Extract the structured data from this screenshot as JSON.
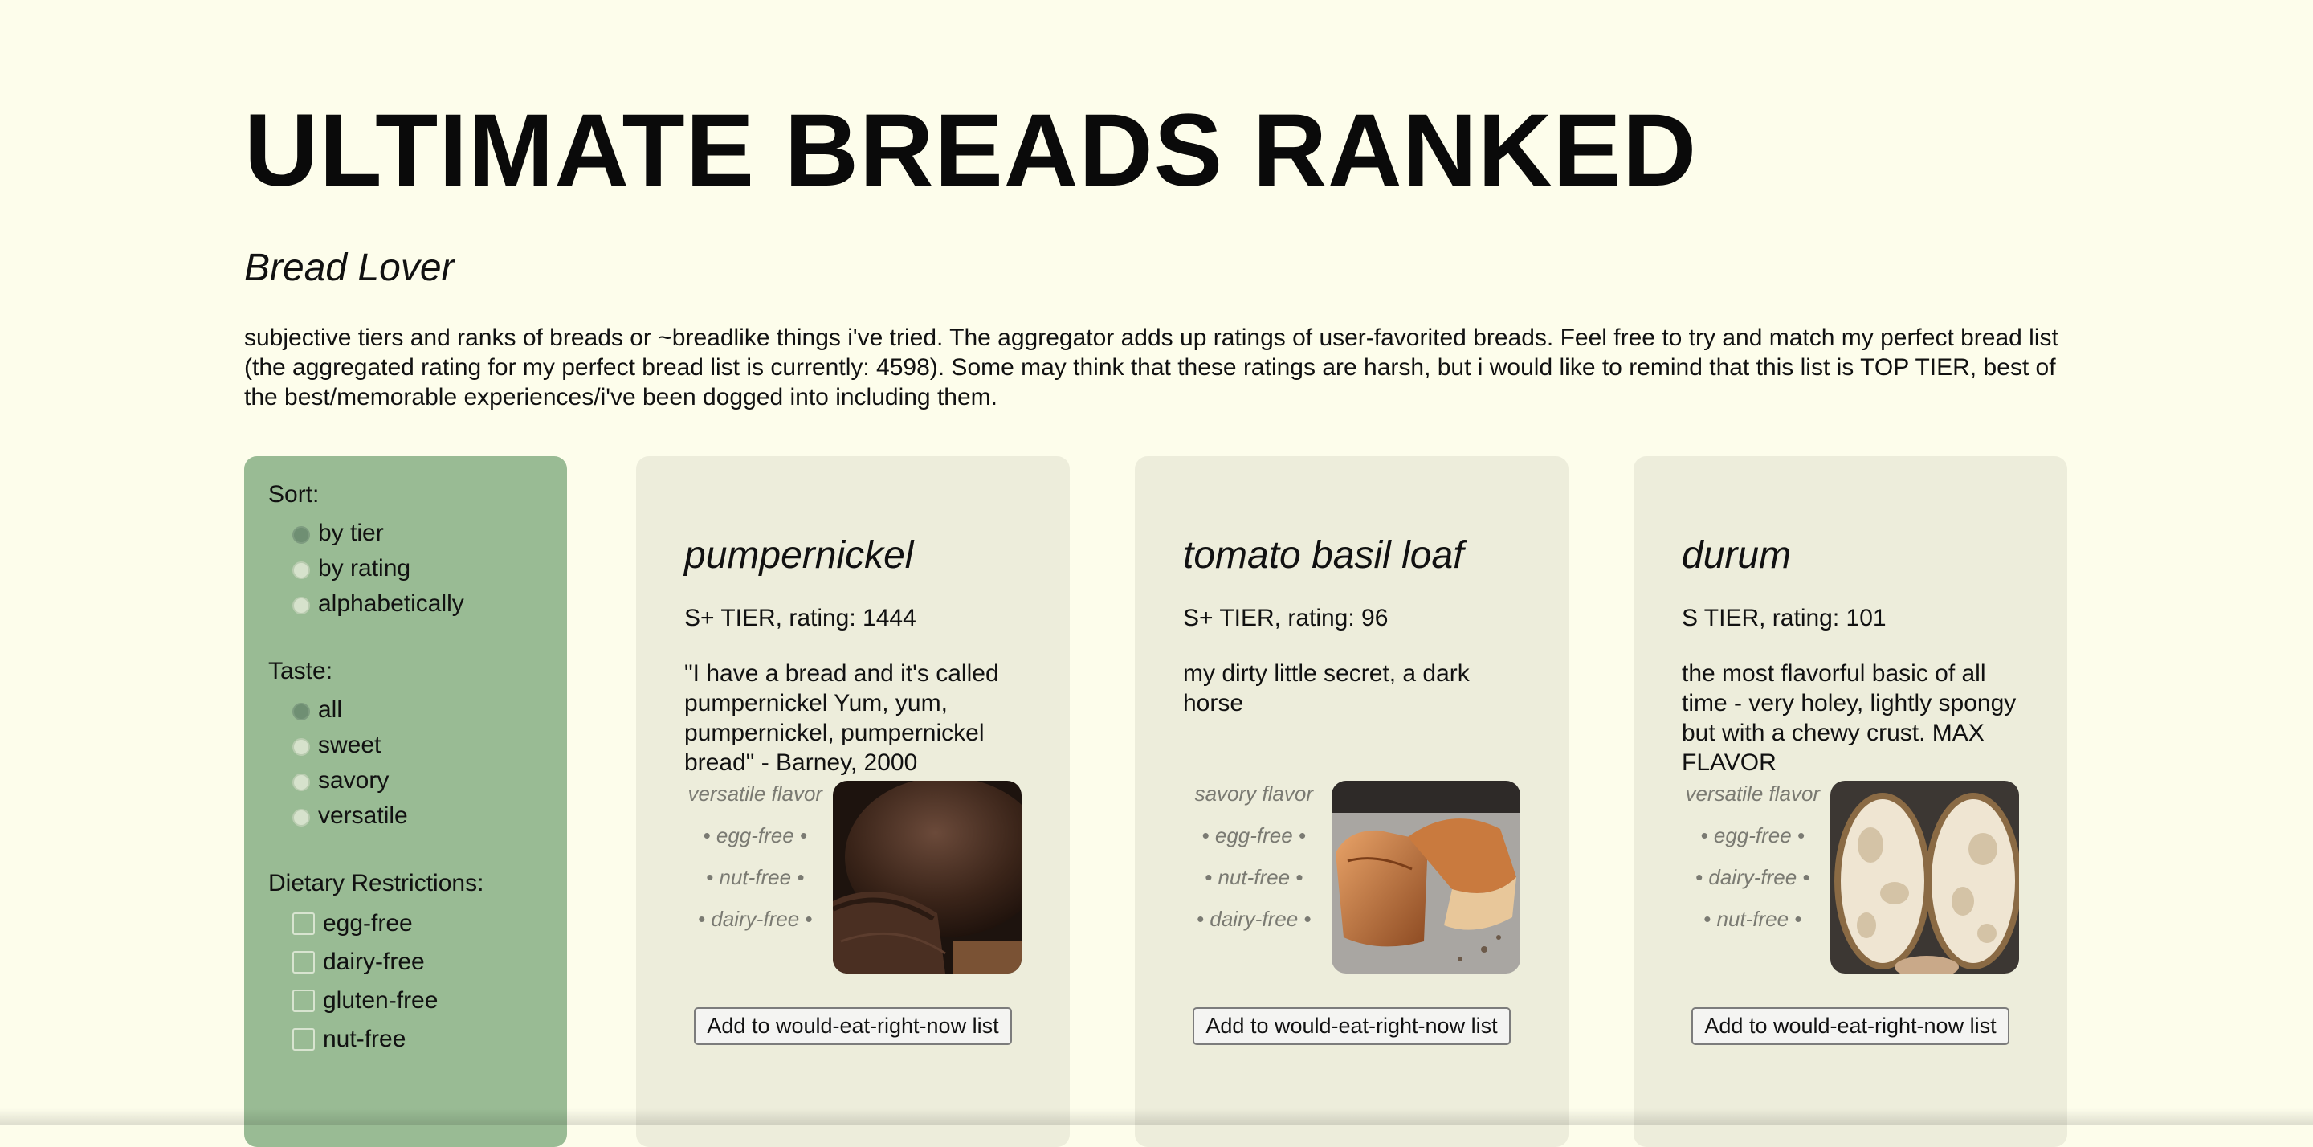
{
  "header": {
    "title": "ULTIMATE BREADS RANKED",
    "subtitle": "Bread Lover",
    "intro": "subjective tiers and ranks of breads or ~breadlike things i've tried. The aggregator adds up ratings of user-favorited breads. Feel free to try and match my perfect bread list (the aggregated rating for my perfect bread list is currently: 4598). Some may think that these ratings are harsh, but i would like to remind that this list is TOP TIER, best of the best/memorable experiences/i've been dogged into including them."
  },
  "sidebar": {
    "sort": {
      "label": "Sort:",
      "options": [
        "by tier",
        "by rating",
        "alphabetically"
      ],
      "selected": "by tier"
    },
    "taste": {
      "label": "Taste:",
      "options": [
        "all",
        "sweet",
        "savory",
        "versatile"
      ],
      "selected": "all"
    },
    "dietary": {
      "label": "Dietary Restrictions:",
      "options": [
        "egg-free",
        "dairy-free",
        "gluten-free",
        "nut-free"
      ]
    }
  },
  "cards": [
    {
      "name": "pumpernickel",
      "tier": "S+ TIER, rating: 1444",
      "description": "\"I have a bread and it's called pumpernickel Yum, yum, pumpernickel, pumpernickel bread\" - Barney, 2000",
      "tags": [
        "versatile flavor",
        "• egg-free •",
        "• nut-free •",
        "• dairy-free •"
      ],
      "photo_icon": "dark-rye-bread-photo",
      "button": "Add to would-eat-right-now list"
    },
    {
      "name": "tomato basil loaf",
      "tier": "S+ TIER, rating: 96",
      "description": "my dirty little secret, a dark horse",
      "tags": [
        "savory flavor",
        "• egg-free •",
        "• nut-free •",
        "• dairy-free •"
      ],
      "photo_icon": "tomato-basil-loaf-photo",
      "button": "Add to would-eat-right-now list"
    },
    {
      "name": "durum",
      "tier": "S TIER, rating: 101",
      "description": "the most flavorful basic of all time - very holey, lightly spongy but with a chewy crust. MAX FLAVOR",
      "tags": [
        "versatile flavor",
        "• egg-free •",
        "• dairy-free •",
        "• nut-free •"
      ],
      "photo_icon": "durum-bread-crumb-photo",
      "button": "Add to would-eat-right-now list"
    }
  ],
  "colors": {
    "page_bg": "#fdfdeb",
    "sidebar_bg": "#99bb94",
    "card_bg": "#ededdb"
  }
}
